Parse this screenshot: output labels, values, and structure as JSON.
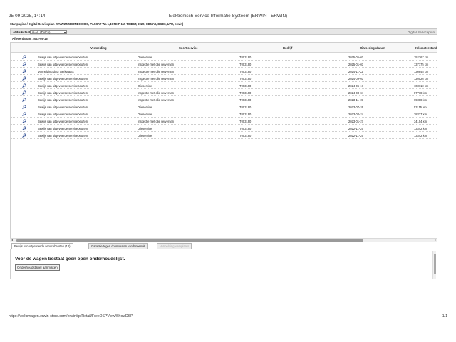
{
  "print_header": {
    "date": "25-09-2025, 14:14",
    "title": "Elektronisch Service Informatie Systeem (ERWIN - ERWIN)"
  },
  "breadcrumb": "Startpagina / Digital Serviceplan (WVWZZZ3CZNE000000, PASSAT Wa 1,4GTE P 115 TSID6T, 2022, CB56YI, DGE8, U7U, erwin)",
  "toolbar": {
    "language_label": "Afdrukstaal:",
    "language_value": "nl-NL (Dutch)",
    "page_title": "Digital Servicepian"
  },
  "reference_date": "Afleverdatum: 2022-05-15",
  "table": {
    "columns": [
      "Vermelding",
      "Soort service",
      "Bedrijf",
      "Uitvoeringsdatum",
      "Kilometerstand"
    ],
    "rows": [
      {
        "vermelding": "Bewijs van uitgevoerde servicebeurten",
        "soort": "Olieservice",
        "bedrijf": "IT003190",
        "datum": "2025-05-02",
        "km": "152767 km"
      },
      {
        "vermelding": "Bewijs van uitgevoerde servicebeurten",
        "soort": "Inspectie met olie verversen",
        "bedrijf": "IT003190",
        "datum": "2025-01-03",
        "km": "137775 km"
      },
      {
        "vermelding": "Vermelding door werkplaats",
        "soort": "Inspectie met olie verversen",
        "bedrijf": "IT003190",
        "datum": "2024-11-22",
        "km": "130845 km"
      },
      {
        "vermelding": "Bewijs van uitgevoerde servicebeurten",
        "soort": "Inspectie met olie verversen",
        "bedrijf": "IT003190",
        "datum": "2024-09-03",
        "km": "120026 km"
      },
      {
        "vermelding": "Bewijs van uitgevoerde servicebeurten",
        "soort": "Olieservice",
        "bedrijf": "IT003190",
        "datum": "2024-06-17",
        "km": "103710 km"
      },
      {
        "vermelding": "Bewijs van uitgevoerde servicebeurten",
        "soort": "Inspectie met olie verversen",
        "bedrijf": "IT003190",
        "datum": "2024-03-04",
        "km": "87718 km"
      },
      {
        "vermelding": "Bewijs van uitgevoerde servicebeurten",
        "soort": "Inspectie met olie verversen",
        "bedrijf": "IT003190",
        "datum": "2023-11-15",
        "km": "69388 km"
      },
      {
        "vermelding": "Bewijs van uitgevoerde servicebeurten",
        "soort": "Olieservice",
        "bedrijf": "IT003190",
        "datum": "2023-07-26",
        "km": "53115 km"
      },
      {
        "vermelding": "Bewijs van uitgevoerde servicebeurten",
        "soort": "Olieservice",
        "bedrijf": "IT003190",
        "datum": "2023-04-24",
        "km": "38327 km"
      },
      {
        "vermelding": "Bewijs van uitgevoerde servicebeurten",
        "soort": "Inspectie met olie verversen",
        "bedrijf": "IT003190",
        "datum": "2023-01-27",
        "km": "34104 km"
      },
      {
        "vermelding": "Bewijs van uitgevoerde servicebeurten",
        "soort": "Olieservice",
        "bedrijf": "IT003190",
        "datum": "2022-11-29",
        "km": "13342 km"
      },
      {
        "vermelding": "Bewijs van uitgevoerde servicebeurten",
        "soort": "Olieservice",
        "bedrijf": "IT003190",
        "datum": "2022-11-29",
        "km": "13342 km"
      }
    ]
  },
  "tabs": [
    {
      "label": "Bewijs van uitgevoerde servicebeurten (12)",
      "active": true
    },
    {
      "label": "Garantie tegen doorroesten van binnenuit",
      "active": false
    },
    {
      "label": "Vermelding werkplaats",
      "active": false,
      "disabled": true
    }
  ],
  "panel": {
    "message": "Voor de wagen bestaat geen open onderhoudslijst.",
    "button": "Onderhoudstabel aanmaken"
  },
  "print_footer": {
    "url": "https://volkswagen.erwin-store.com/erwin/rp/Retail/FreeDSPView/ShowDSP",
    "pages": "1/1"
  },
  "colors": {
    "toolbar_bg": "#e6e6e6",
    "header_bg": "#f7f7f7",
    "icon_blue": "#1e3f8a"
  }
}
